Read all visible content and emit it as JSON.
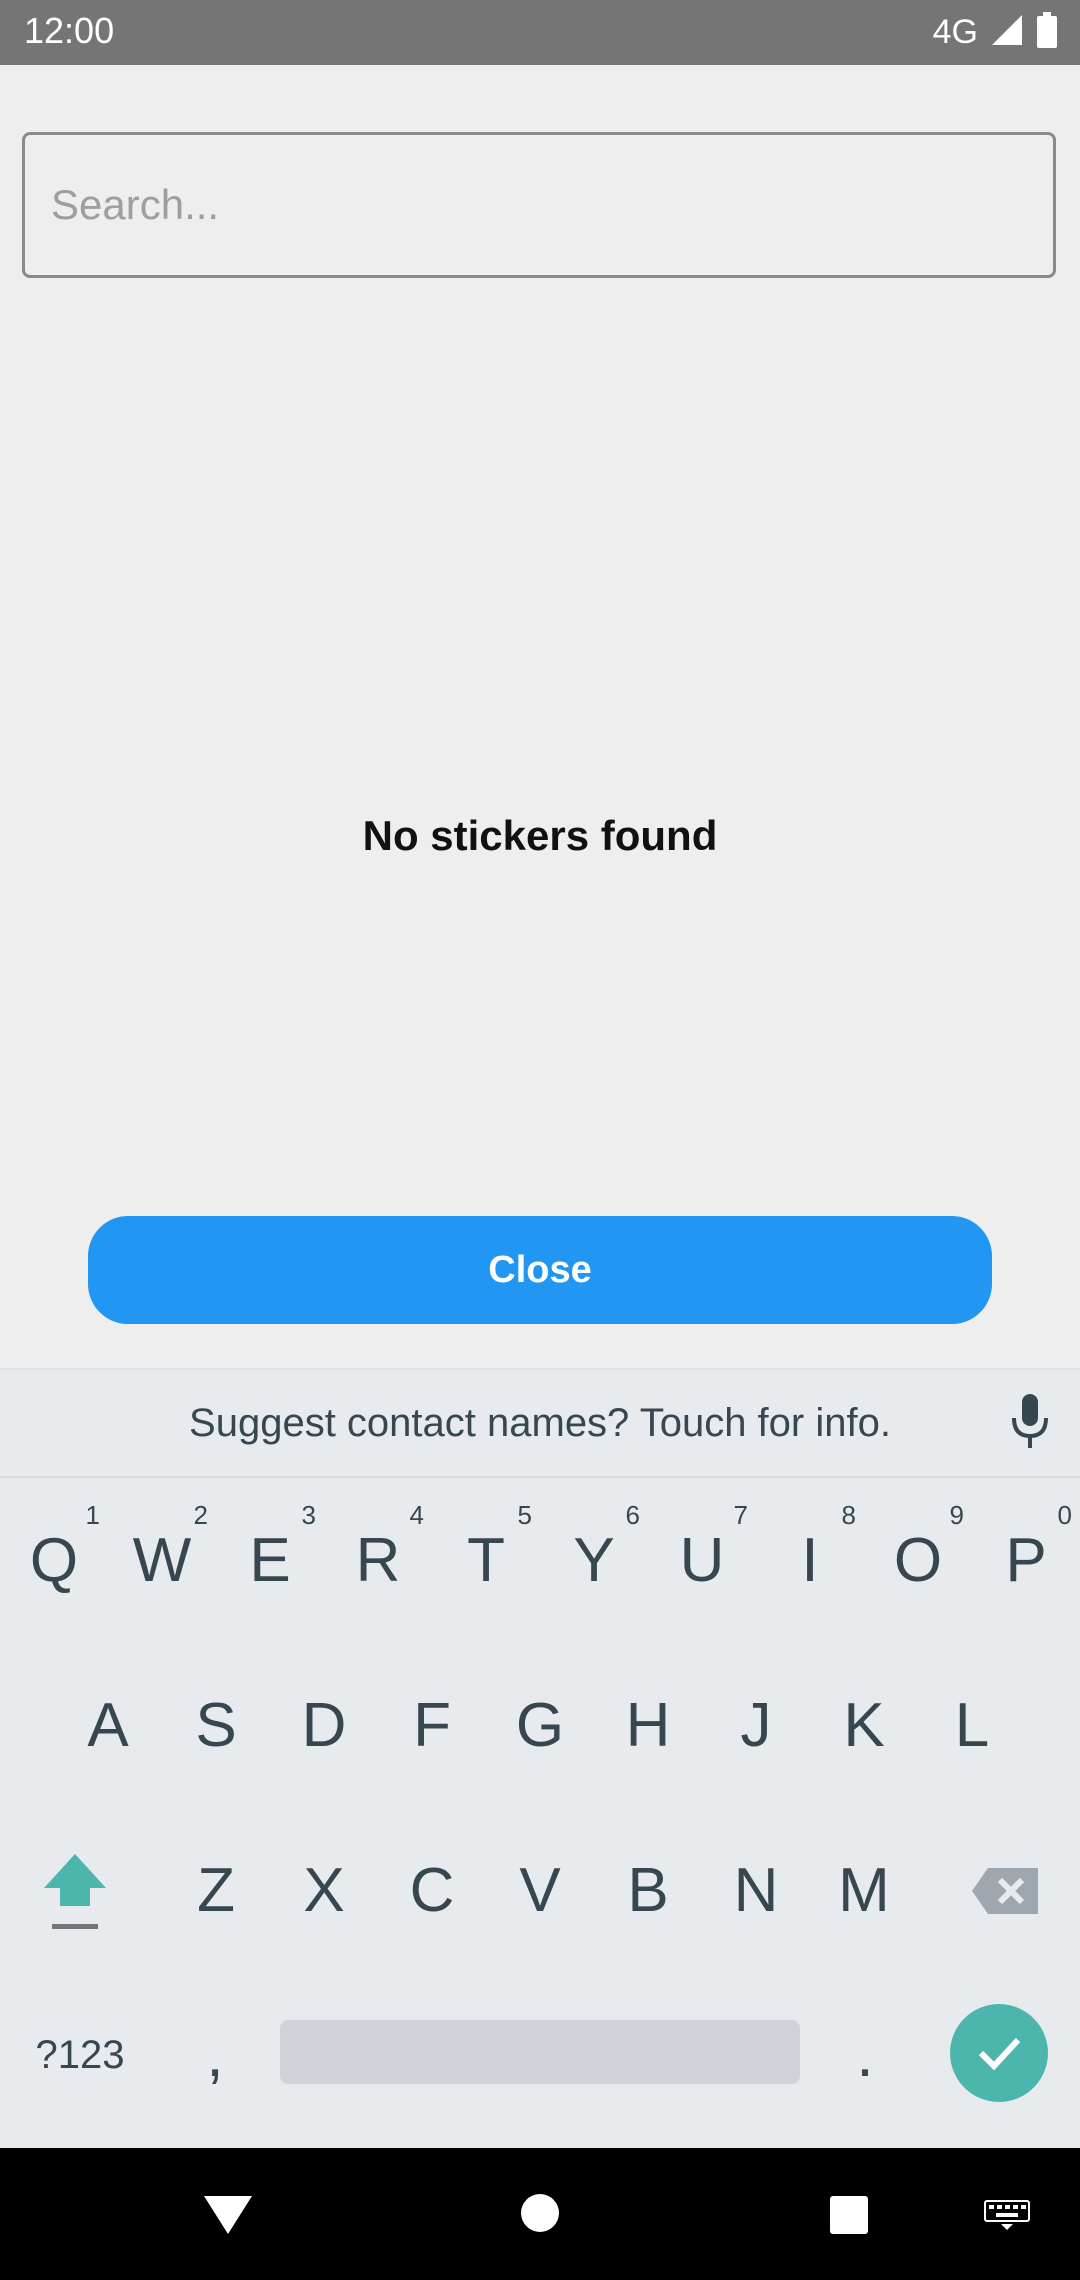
{
  "status_bar": {
    "time": "12:00",
    "network": "4G"
  },
  "search": {
    "placeholder": "Search..."
  },
  "empty_state": {
    "message": "No stickers found"
  },
  "actions": {
    "close_label": "Close"
  },
  "keyboard": {
    "suggestion": "Suggest contact names? Touch for info.",
    "row1": [
      {
        "key": "Q",
        "hint": "1"
      },
      {
        "key": "W",
        "hint": "2"
      },
      {
        "key": "E",
        "hint": "3"
      },
      {
        "key": "R",
        "hint": "4"
      },
      {
        "key": "T",
        "hint": "5"
      },
      {
        "key": "Y",
        "hint": "6"
      },
      {
        "key": "U",
        "hint": "7"
      },
      {
        "key": "I",
        "hint": "8"
      },
      {
        "key": "O",
        "hint": "9"
      },
      {
        "key": "P",
        "hint": "0"
      }
    ],
    "row2": [
      "A",
      "S",
      "D",
      "F",
      "G",
      "H",
      "J",
      "K",
      "L"
    ],
    "row3": [
      "Z",
      "X",
      "C",
      "V",
      "B",
      "N",
      "M"
    ],
    "symbols_key": "?123",
    "comma_key": ",",
    "period_key": "."
  },
  "colors": {
    "accent": "#2196f3",
    "keyboard_accent": "#4db6ac",
    "status_bar": "#757575"
  }
}
